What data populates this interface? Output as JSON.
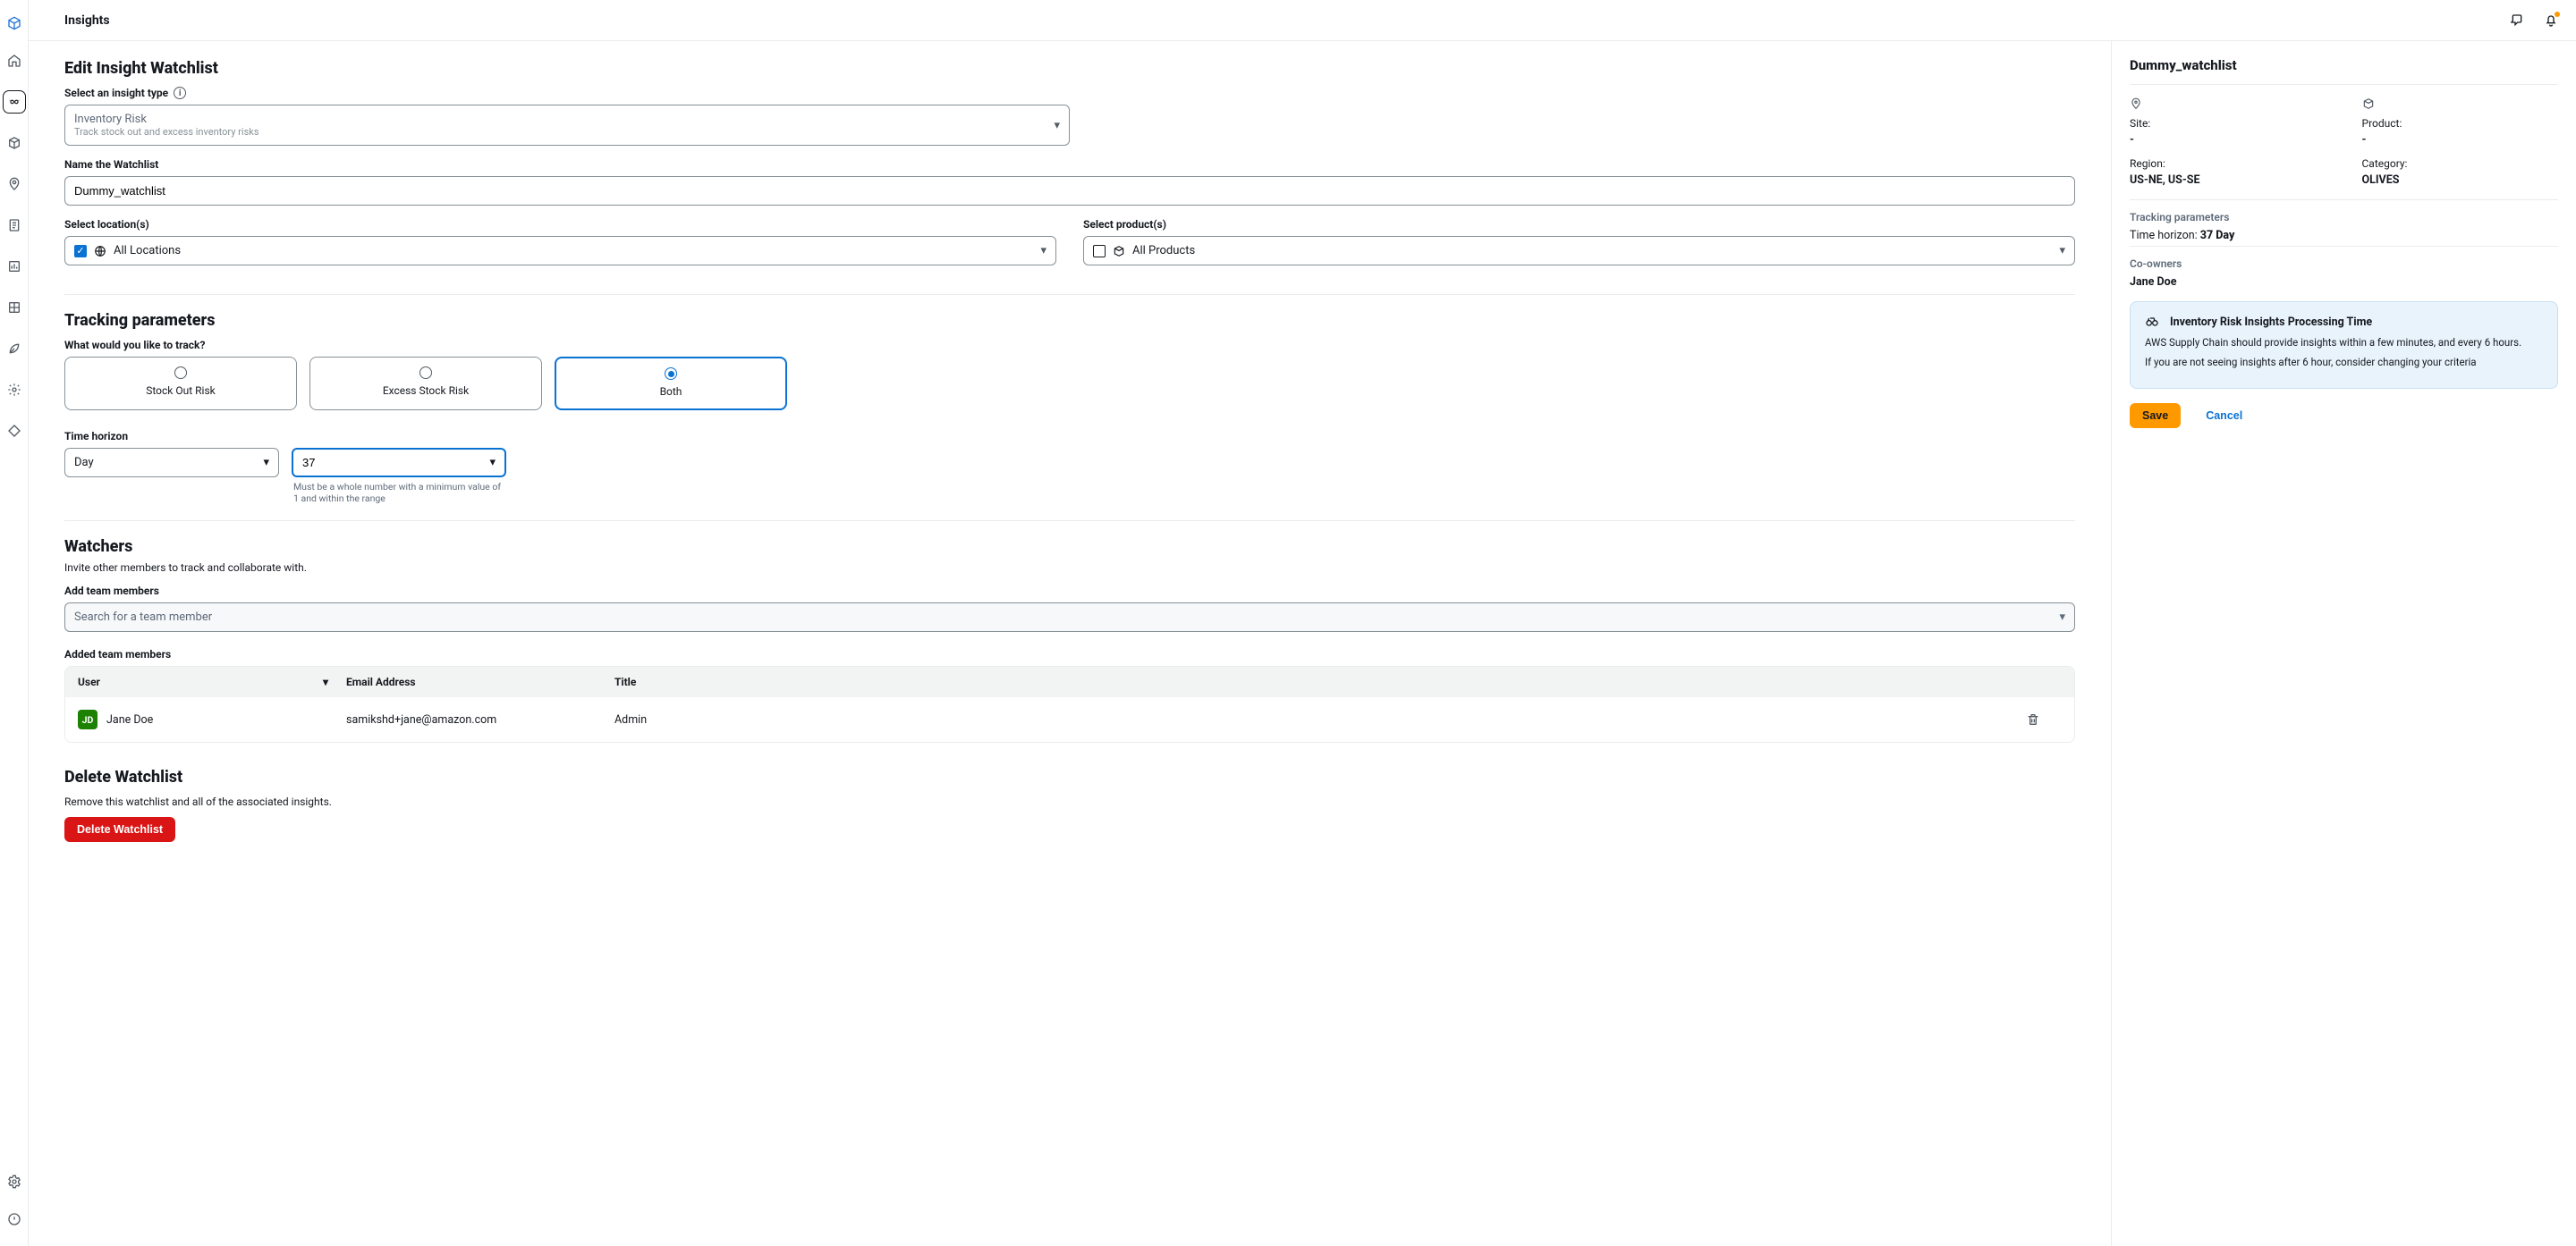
{
  "topbar": {
    "title": "Insights"
  },
  "page": {
    "heading": "Edit Insight Watchlist",
    "insight_type": {
      "label": "Select an insight type",
      "value_title": "Inventory Risk",
      "value_desc": "Track stock out and excess inventory risks"
    },
    "name": {
      "label": "Name the Watchlist",
      "value": "Dummy_watchlist"
    },
    "locations": {
      "label": "Select location(s)",
      "value": "All Locations",
      "checked": true
    },
    "products": {
      "label": "Select product(s)",
      "value": "All Products",
      "checked": false
    },
    "tracking": {
      "heading": "Tracking parameters",
      "question": "What would you like to track?",
      "options": [
        "Stock Out Risk",
        "Excess Stock Risk",
        "Both"
      ],
      "selected": "Both",
      "time_label": "Time horizon",
      "time_unit": "Day",
      "time_value": "37",
      "time_hint": "Must be a whole number with a minimum value of 1 and within the range"
    },
    "watchers": {
      "heading": "Watchers",
      "desc": "Invite other members to track and collaborate with.",
      "add_label": "Add team members",
      "search_placeholder": "Search for a team member",
      "added_label": "Added team members",
      "cols": {
        "user": "User",
        "email": "Email Address",
        "title": "Title"
      },
      "rows": [
        {
          "initials": "JD",
          "name": "Jane Doe",
          "email": "samikshd+jane@amazon.com",
          "title": "Admin"
        }
      ]
    },
    "delete": {
      "heading": "Delete Watchlist",
      "desc": "Remove this watchlist and all of the associated insights.",
      "button": "Delete Watchlist"
    }
  },
  "side": {
    "title": "Dummy_watchlist",
    "site_label": "Site:",
    "site_value": "-",
    "product_label": "Product:",
    "product_value": "-",
    "region_label": "Region:",
    "region_value": "US-NE, US-SE",
    "category_label": "Category:",
    "category_value": "OLIVES",
    "tracking_label": "Tracking parameters",
    "time_text": "Time horizon: ",
    "time_val": "37 Day",
    "coowners_label": "Co-owners",
    "coowners_value": "Jane Doe",
    "info": {
      "title": "Inventory Risk Insights Processing Time",
      "line1": "AWS Supply Chain should provide insights within a few minutes, and every 6 hours.",
      "line2": "If you are not seeing insights after 6 hour, consider changing your criteria"
    },
    "save": "Save",
    "cancel": "Cancel"
  }
}
